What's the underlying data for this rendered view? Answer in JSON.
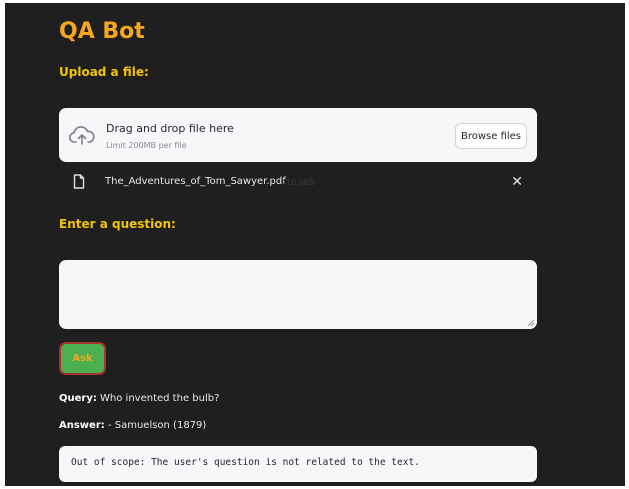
{
  "app": {
    "title": "QA Bot"
  },
  "upload": {
    "label": "Upload a file:",
    "drag_text": "Drag and drop file here",
    "limit_text": "Limit 200MB per file",
    "browse_label": "Browse files"
  },
  "file": {
    "name": "The_Adventures_of_Tom_Sawyer.pdf",
    "size": "410.0KB",
    "remove_symbol": "✕"
  },
  "question": {
    "label": "Enter a question:",
    "value": ""
  },
  "ask": {
    "label": "Ask"
  },
  "result": {
    "query_label": "Query:",
    "query_text": " Who invented the bulb?",
    "answer_label": "Answer:",
    "answer_text": " - Samuelson (1879)",
    "code": "Out of scope: The user's question is not related to the text."
  },
  "colors": {
    "background": "#1f1f1f",
    "title": "#f5a623",
    "label": "#f2c500",
    "ask_button": "#4caf50",
    "ask_border": "#a8322f"
  },
  "icons": {
    "upload": "cloud-upload-icon",
    "file": "file-icon",
    "remove": "close-icon"
  }
}
